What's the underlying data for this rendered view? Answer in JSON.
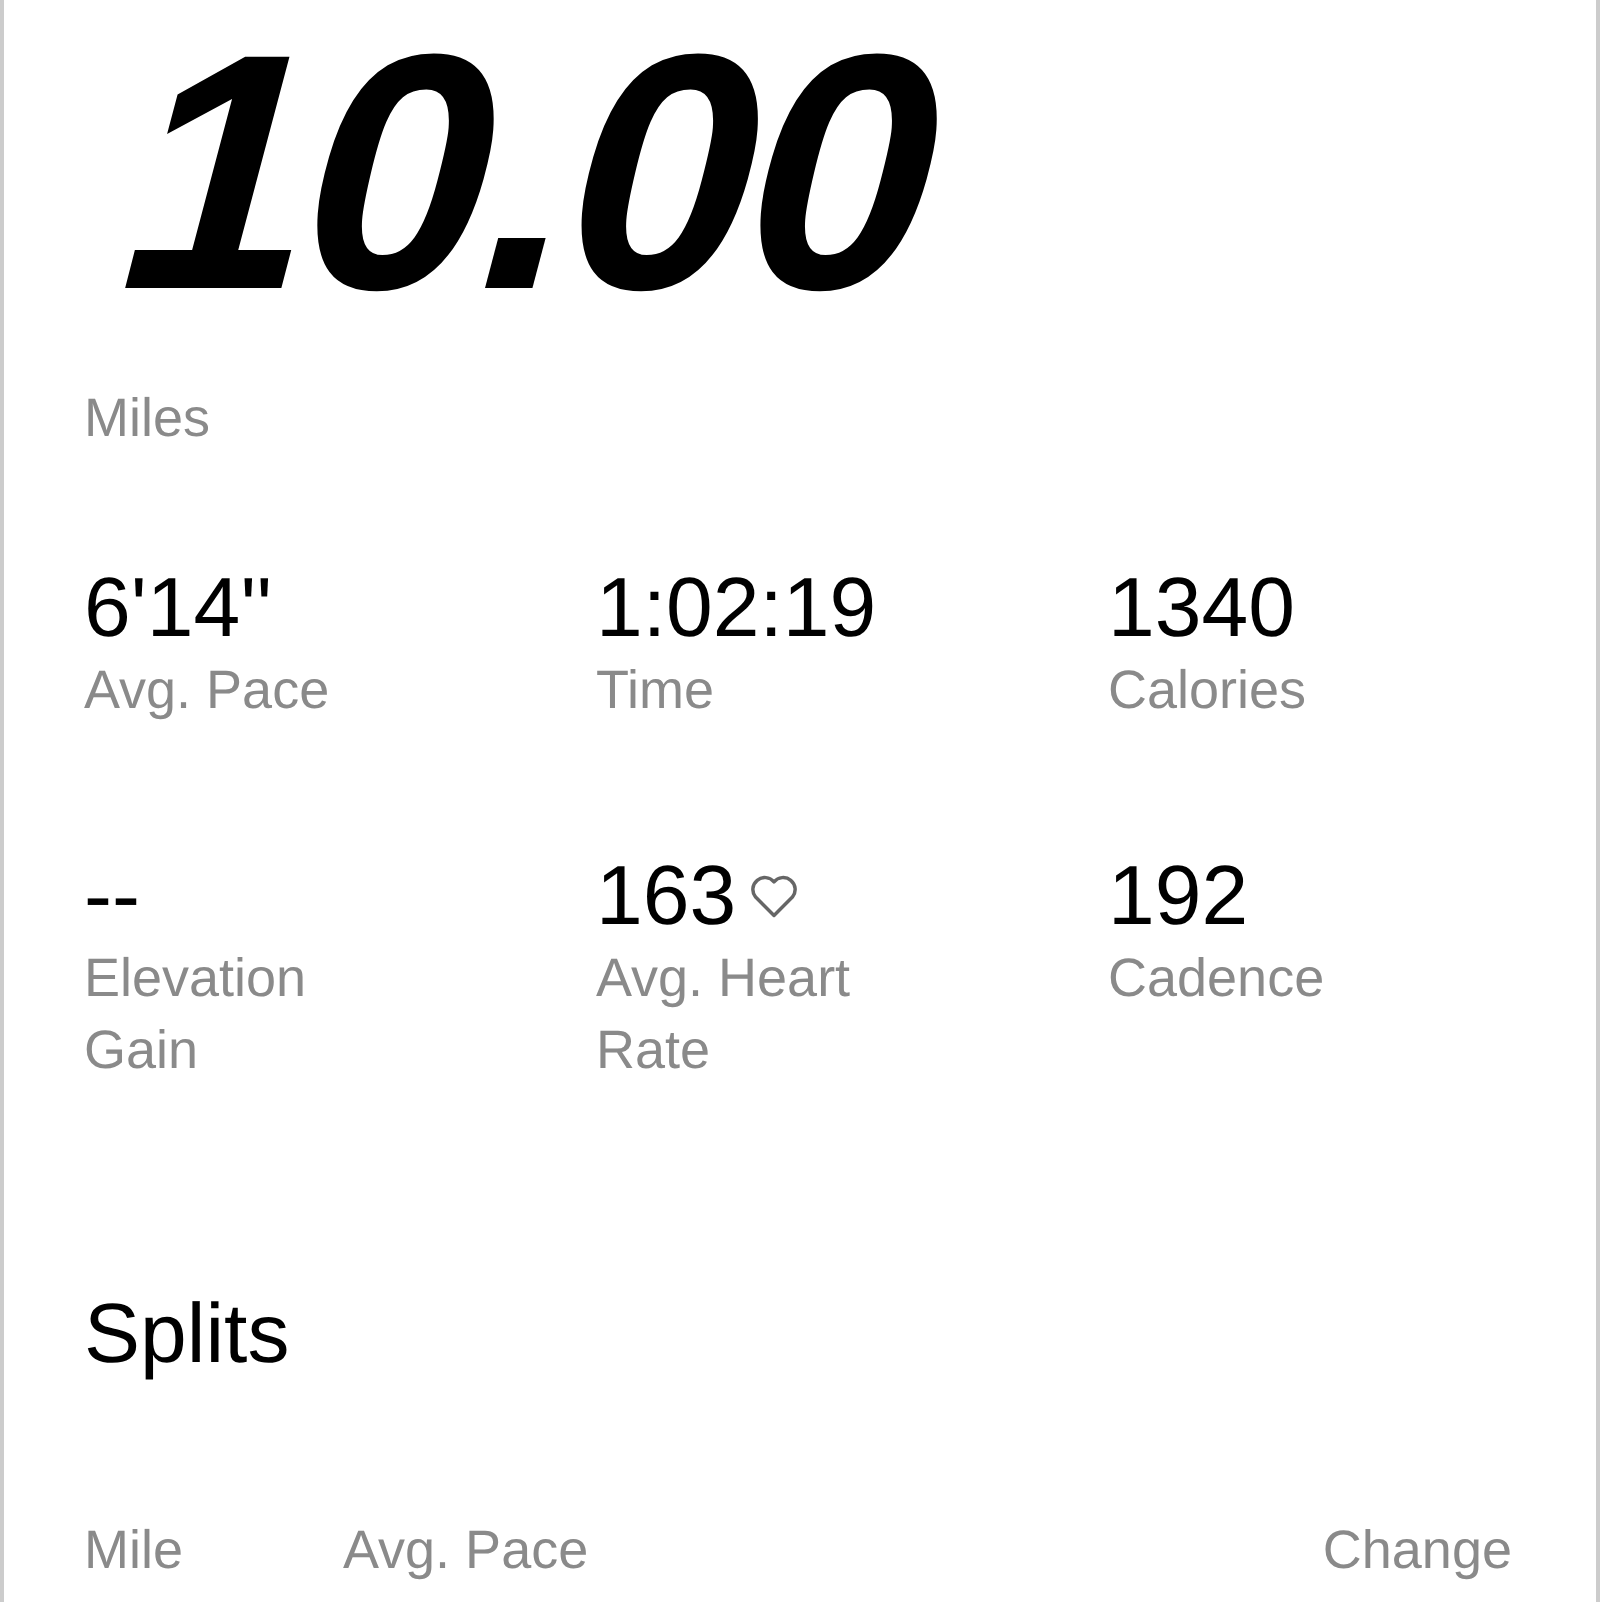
{
  "distance": {
    "value": "10.00",
    "unit": "Miles"
  },
  "stats": [
    {
      "value": "6'14''",
      "label": "Avg. Pace",
      "heart": false
    },
    {
      "value": "1:02:19",
      "label": "Time",
      "heart": false
    },
    {
      "value": "1340",
      "label": "Calories",
      "heart": false
    },
    {
      "value": "--",
      "label": "Elevation Gain",
      "heart": false
    },
    {
      "value": "163",
      "label": "Avg. Heart Rate",
      "heart": true
    },
    {
      "value": "192",
      "label": "Cadence",
      "heart": false
    }
  ],
  "splits": {
    "title": "Splits",
    "columns": [
      "Mile",
      "Avg. Pace",
      "Change"
    ]
  }
}
